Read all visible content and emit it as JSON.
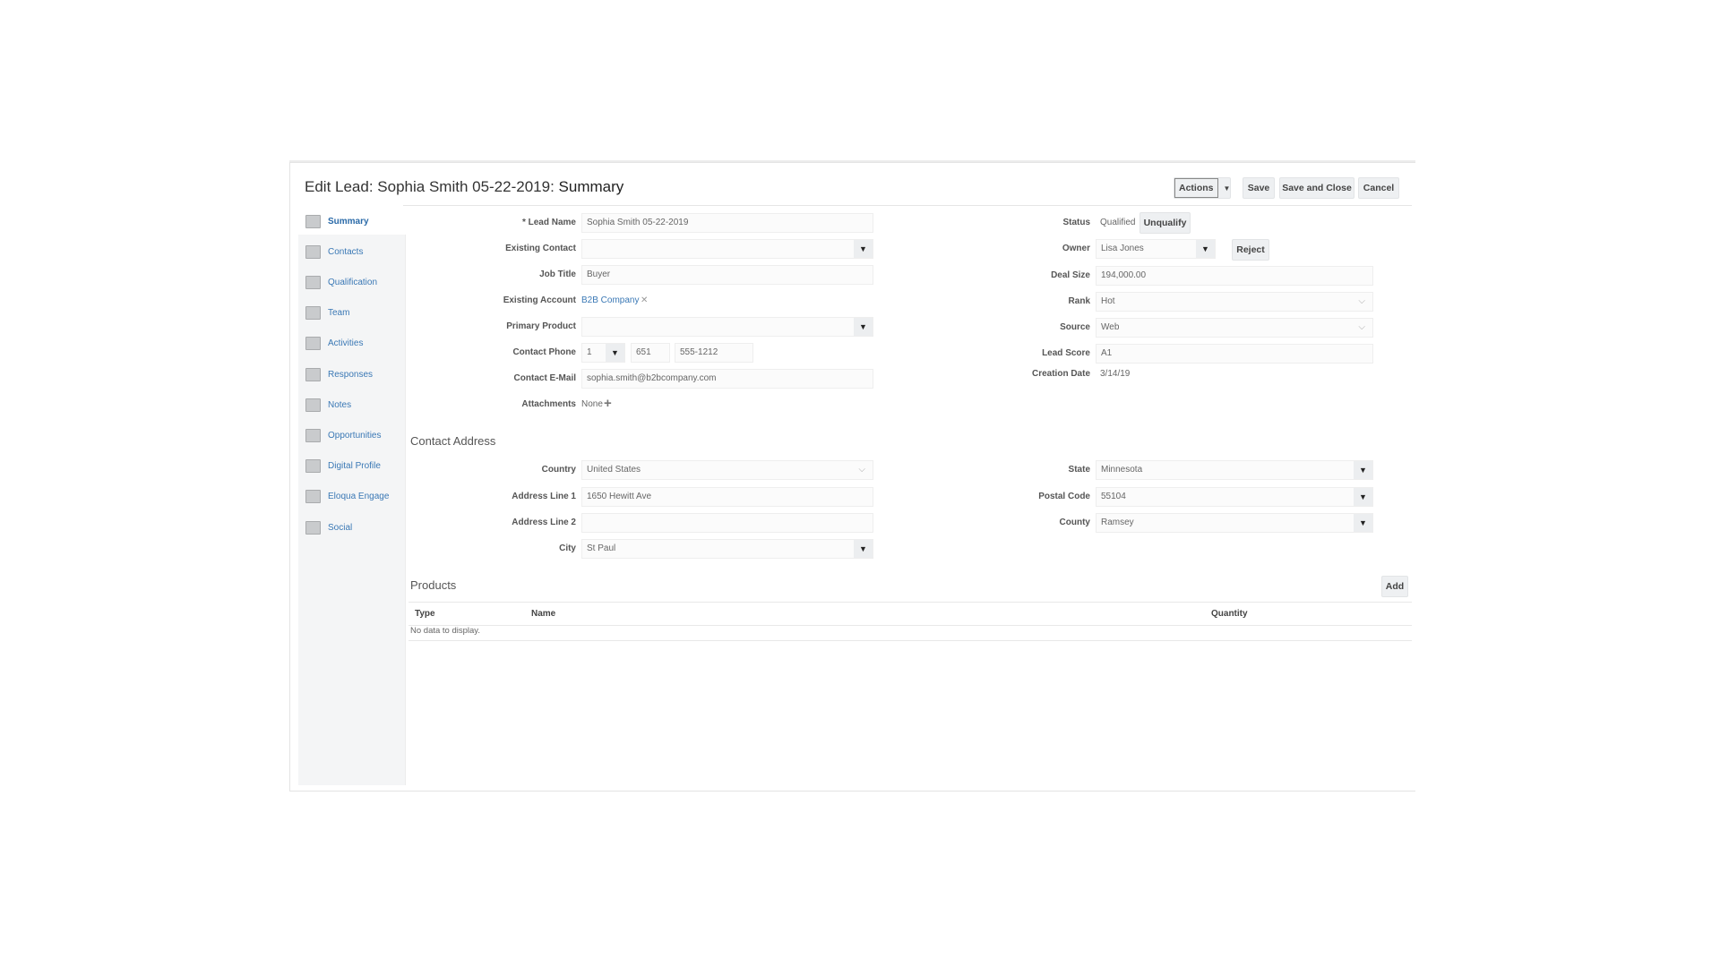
{
  "header": {
    "title_prefix": "Edit Lead: Sophia Smith 05-22-2019:",
    "title_section": "Summary",
    "actions": "Actions",
    "save": "Save",
    "save_close": "Save and Close",
    "cancel": "Cancel"
  },
  "sidebar": {
    "items": [
      {
        "label": "Summary"
      },
      {
        "label": "Contacts"
      },
      {
        "label": "Qualification"
      },
      {
        "label": "Team"
      },
      {
        "label": "Activities"
      },
      {
        "label": "Responses"
      },
      {
        "label": "Notes"
      },
      {
        "label": "Opportunities"
      },
      {
        "label": "Digital Profile"
      },
      {
        "label": "Eloqua Engage"
      },
      {
        "label": "Social"
      }
    ]
  },
  "left": {
    "lead_name": {
      "label": "Lead Name",
      "required": "*",
      "value": "Sophia Smith 05-22-2019"
    },
    "existing_contact": {
      "label": "Existing Contact",
      "value": ""
    },
    "job_title": {
      "label": "Job Title",
      "value": "Buyer"
    },
    "existing_account": {
      "label": "Existing Account",
      "value": "B2B Company",
      "remove": "✕"
    },
    "primary_product": {
      "label": "Primary Product",
      "value": ""
    },
    "contact_phone": {
      "label": "Contact Phone",
      "country": "1",
      "area": "651",
      "number": "555-1212"
    },
    "email": {
      "label": "Contact E-Mail",
      "value": "sophia.smith@b2bcompany.com"
    },
    "attachments": {
      "label": "Attachments",
      "value": "None"
    }
  },
  "right": {
    "status": {
      "label": "Status",
      "value": "Qualified",
      "button": "Unqualify"
    },
    "owner": {
      "label": "Owner",
      "value": "Lisa Jones",
      "button": "Reject"
    },
    "deal_size": {
      "label": "Deal Size",
      "value": "194,000.00"
    },
    "rank": {
      "label": "Rank",
      "value": "Hot"
    },
    "source": {
      "label": "Source",
      "value": "Web"
    },
    "lead_score": {
      "label": "Lead Score",
      "value": "A1"
    },
    "creation_date": {
      "label": "Creation Date",
      "value": "3/14/19"
    }
  },
  "address": {
    "title": "Contact Address",
    "country": {
      "label": "Country",
      "value": "United States"
    },
    "line1": {
      "label": "Address Line 1",
      "value": "1650 Hewitt Ave"
    },
    "line2": {
      "label": "Address Line 2",
      "value": ""
    },
    "city": {
      "label": "City",
      "value": "St Paul"
    },
    "state": {
      "label": "State",
      "value": "Minnesota"
    },
    "postal": {
      "label": "Postal Code",
      "value": "55104"
    },
    "county": {
      "label": "County",
      "value": "Ramsey"
    }
  },
  "products": {
    "title": "Products",
    "add": "Add",
    "columns": [
      "Type",
      "Name",
      "Quantity"
    ],
    "empty": "No data to display."
  }
}
